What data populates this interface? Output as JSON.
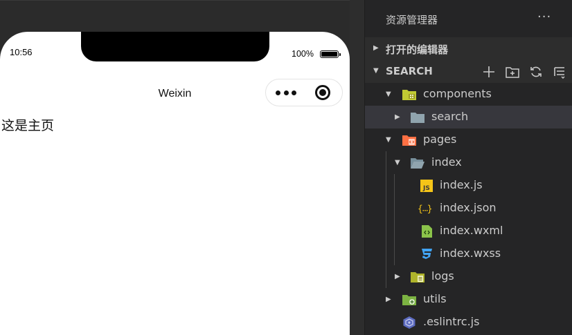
{
  "simulator": {
    "status_time": "10:56",
    "battery_text": "100%",
    "nav_title": "Weixin",
    "page_text": "这是主页",
    "capsule_menu_icon": "more-dots-icon",
    "capsule_close_icon": "target-icon"
  },
  "explorer": {
    "title": "资源管理器",
    "more": "···",
    "open_editors_label": "打开的编辑器",
    "project_label": "SEARCH",
    "actions": [
      "new-file-icon",
      "new-folder-icon",
      "refresh-icon",
      "collapse-all-icon"
    ],
    "tree": [
      {
        "name": "components",
        "icon": "components-folder-icon",
        "expanded": true
      },
      {
        "name": "search",
        "icon": "folder-icon",
        "expanded": false,
        "selected": true
      },
      {
        "name": "pages",
        "icon": "pages-folder-icon",
        "expanded": true
      },
      {
        "name": "index",
        "icon": "folder-open-icon",
        "expanded": true
      },
      {
        "name": "index.js",
        "icon": "js-file-icon"
      },
      {
        "name": "index.json",
        "icon": "json-file-icon"
      },
      {
        "name": "index.wxml",
        "icon": "wxml-file-icon"
      },
      {
        "name": "index.wxss",
        "icon": "wxss-file-icon"
      },
      {
        "name": "logs",
        "icon": "logs-folder-icon",
        "expanded": false
      },
      {
        "name": "utils",
        "icon": "utils-folder-icon",
        "expanded": false
      },
      {
        "name": ".eslintrc.js",
        "icon": "eslint-file-icon"
      }
    ]
  },
  "colors": {
    "sidebar_bg": "#252526",
    "selected_bg": "#37373d",
    "js_yellow": "#f5c518",
    "wxss_blue": "#42a5f5",
    "wxml_green": "#8bc34a",
    "pages_orange": "#ff7043"
  }
}
